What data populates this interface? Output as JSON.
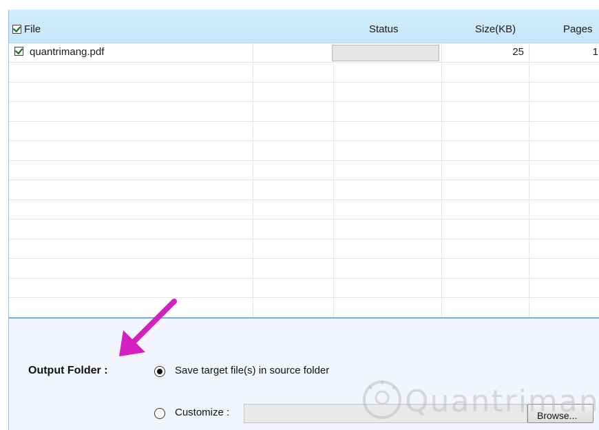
{
  "list": {
    "columns": {
      "file": "File",
      "status": "Status",
      "size": "Size(KB)",
      "pages": "Pages"
    },
    "select_all_checked": true,
    "rows": [
      {
        "checked": true,
        "file": "quantrimang.pdf",
        "status": "",
        "size": "25",
        "pages": "1"
      }
    ]
  },
  "output": {
    "label": "Output Folder :",
    "option_source": "Save target file(s) in source folder",
    "option_custom": "Customize :",
    "selected": "source",
    "path_value": "",
    "browse_label": "Browse..."
  },
  "watermark": {
    "text": "Quantrimang"
  },
  "colors": {
    "header_bg": "#cde9fb",
    "panel_border": "#74aee2",
    "annotation_arrow": "#d61fc0",
    "check_green": "#0e6b14"
  }
}
